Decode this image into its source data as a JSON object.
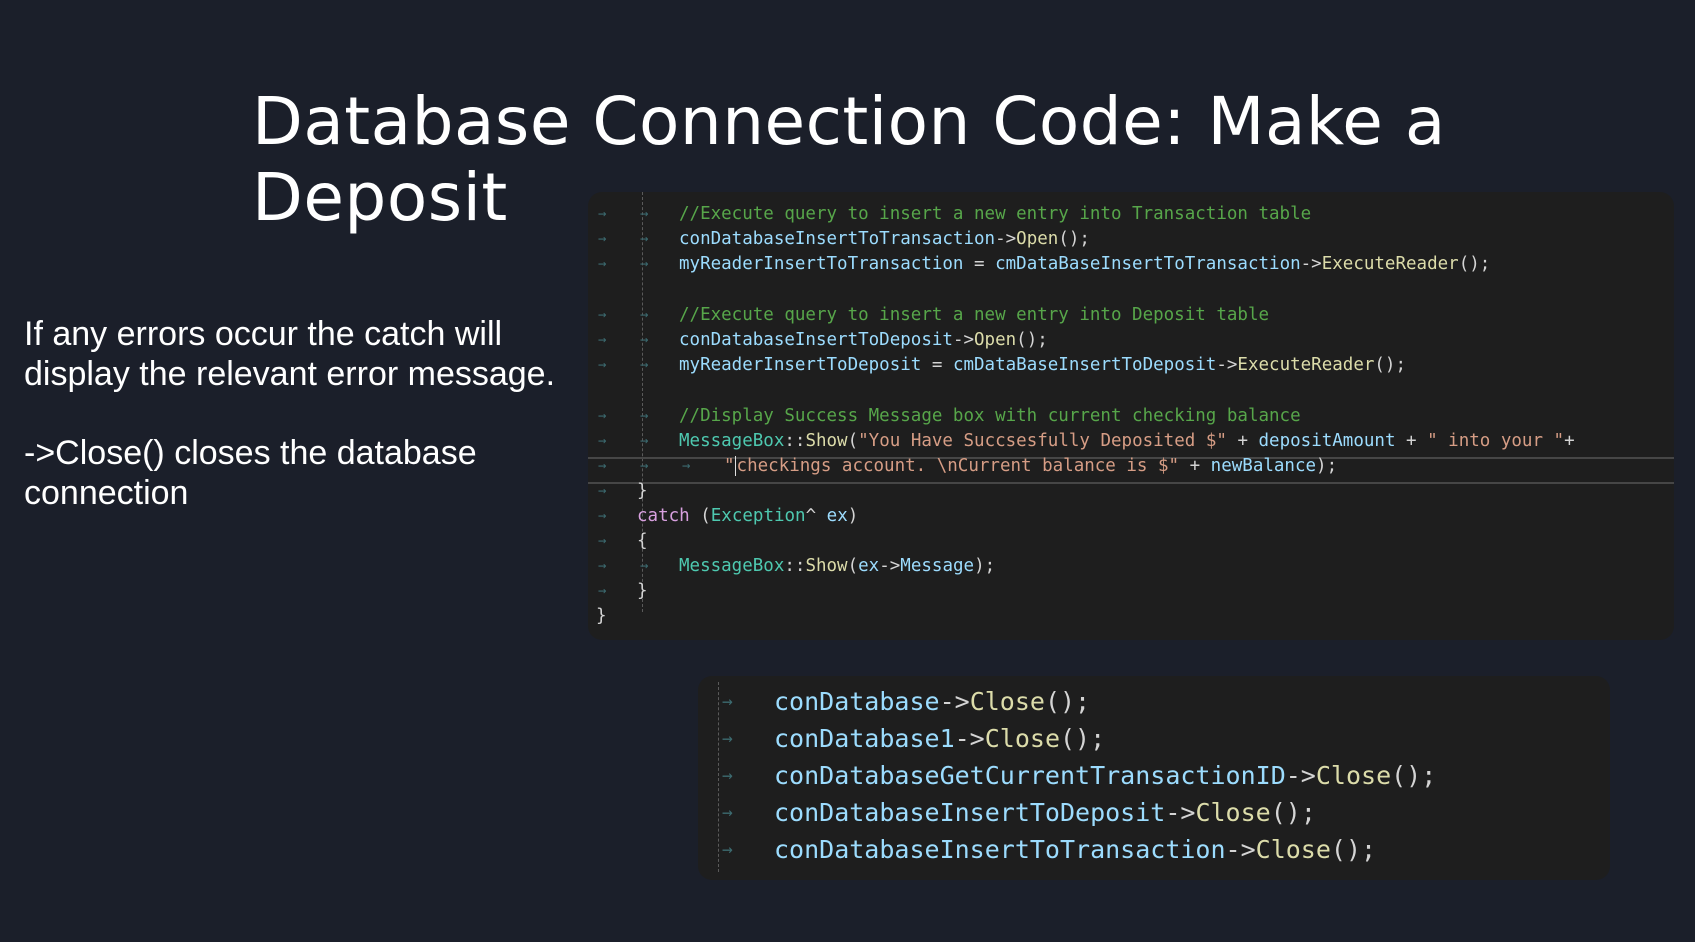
{
  "slide": {
    "title_line1": "Database Connection Code: Make a",
    "title_line2": "Deposit",
    "paragraph1": "If any errors occur the catch will display the relevant error message.",
    "paragraph2": "->Close() closes the database connection"
  },
  "code_block_1": {
    "comment1": "//Execute query to insert a new entry into Transaction table",
    "l2_obj": "conDatabaseInsertToTransaction",
    "l2_op": "->",
    "l2_fn": "Open",
    "l2_end": "();",
    "l3_var": "myReaderInsertToTransaction",
    "l3_eq": " = ",
    "l3_cmd": "cmDataBaseInsertToTransaction",
    "l3_op": "->",
    "l3_fn": "ExecuteReader",
    "l3_end": "();",
    "comment2": "//Execute query to insert a new entry into Deposit table",
    "l5_obj": "conDatabaseInsertToDeposit",
    "l5_op": "->",
    "l5_fn": "Open",
    "l5_end": "();",
    "l6_var": "myReaderInsertToDeposit",
    "l6_eq": " = ",
    "l6_cmd": "cmDataBaseInsertToDeposit",
    "l6_op": "->",
    "l6_fn": "ExecuteReader",
    "l6_end": "();",
    "comment3": "//Display Success Message box with current checking balance",
    "l8_class": "MessageBox",
    "l8_scope": "::",
    "l8_fn": "Show",
    "l8_open": "(",
    "l8_str1": "\"You Have Succsesfully Deposited $\"",
    "l8_plus1": " + ",
    "l8_var": "depositAmount",
    "l8_plus2": " + ",
    "l8_str2": "\" into your \"",
    "l8_plus3": "+",
    "l9_q": "\"",
    "l9_str": "checkings account. \\nCurrent balance is $\"",
    "l9_plus": " + ",
    "l9_var": "newBalance",
    "l9_end": ");",
    "close_brace": "}",
    "catch_kw": "catch",
    "catch_open": " (",
    "catch_type": "Exception",
    "catch_hat": "^ ",
    "catch_var": "ex",
    "catch_close": ")",
    "open_brace": "{",
    "l13_class": "MessageBox",
    "l13_scope": "::",
    "l13_fn": "Show",
    "l13_open": "(",
    "l13_var": "ex",
    "l13_op": "->",
    "l13_prop": "Message",
    "l13_end": ");",
    "brace_inner": "}",
    "brace_outer": "}"
  },
  "code_block_2": {
    "lines": [
      {
        "obj": "conDatabase",
        "op": "->",
        "fn": "Close",
        "end": "();"
      },
      {
        "obj": "conDatabase1",
        "op": "->",
        "fn": "Close",
        "end": "();"
      },
      {
        "obj": "conDatabaseGetCurrentTransactionID",
        "op": "->",
        "fn": "Close",
        "end": "();"
      },
      {
        "obj": "conDatabaseInsertToDeposit",
        "op": "->",
        "fn": "Close",
        "end": "();"
      },
      {
        "obj": "conDatabaseInsertToTransaction",
        "op": "->",
        "fn": "Close",
        "end": "();"
      }
    ]
  },
  "colors": {
    "background": "#1b1f2a",
    "editor": "#1e1e1e",
    "comment": "#57a64a",
    "variable": "#9cdcfe",
    "function": "#dcdcaa",
    "string": "#d69d85",
    "keyword": "#d8a0df",
    "type": "#4ec9b0"
  }
}
